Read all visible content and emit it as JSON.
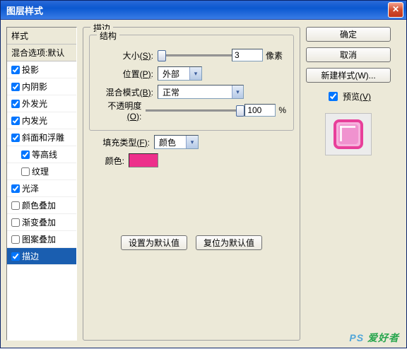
{
  "window": {
    "title": "图层样式"
  },
  "buttons": {
    "ok": "确定",
    "cancel": "取消",
    "new_style": "新建样式(W)...",
    "preview_label": "预览",
    "preview_key": "(V)"
  },
  "left": {
    "header": "样式",
    "sub": "混合选项:默认",
    "items": [
      {
        "label": "投影",
        "checked": true,
        "indent": false
      },
      {
        "label": "内阴影",
        "checked": true,
        "indent": false
      },
      {
        "label": "外发光",
        "checked": true,
        "indent": false
      },
      {
        "label": "内发光",
        "checked": true,
        "indent": false
      },
      {
        "label": "斜面和浮雕",
        "checked": true,
        "indent": false
      },
      {
        "label": "等高线",
        "checked": true,
        "indent": true
      },
      {
        "label": "纹理",
        "checked": false,
        "indent": true
      },
      {
        "label": "光泽",
        "checked": true,
        "indent": false
      },
      {
        "label": "颜色叠加",
        "checked": false,
        "indent": false
      },
      {
        "label": "渐变叠加",
        "checked": false,
        "indent": false
      },
      {
        "label": "图案叠加",
        "checked": false,
        "indent": false
      },
      {
        "label": "描边",
        "checked": true,
        "indent": false,
        "selected": true
      }
    ]
  },
  "stroke": {
    "legend": "描边",
    "struct_legend": "结构",
    "size_label": "大小",
    "size_key": "(S)",
    "size_value": "3",
    "size_unit": "像素",
    "position_label": "位置",
    "position_key": "(P)",
    "position_value": "外部",
    "blend_label": "混合模式",
    "blend_key": "(B)",
    "blend_value": "正常",
    "opacity_label": "不透明度",
    "opacity_key": "(O)",
    "opacity_value": "100",
    "opacity_unit": "%",
    "fill_type_label": "填充类型",
    "fill_type_key": "(F)",
    "fill_type_value": "颜色",
    "color_label": "颜色:",
    "color_value": "#ed2f8b",
    "set_default": "设置为默认值",
    "reset_default": "复位为默认值"
  },
  "watermark": {
    "a": "PS",
    "b": " 爱好者"
  }
}
